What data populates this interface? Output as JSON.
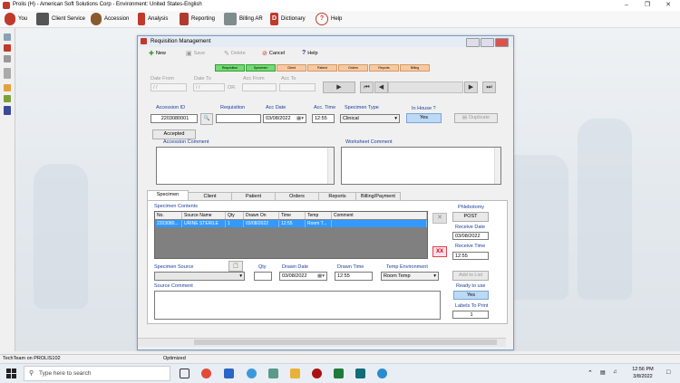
{
  "window": {
    "title": "Prolis (H) - American Soft Solutions Corp - Environment: United States-English"
  },
  "menu": [
    {
      "label": "You",
      "color": "#c0392b"
    },
    {
      "label": "Client Service",
      "color": "#555555"
    },
    {
      "label": "Accession",
      "color": "#8b5a2b"
    },
    {
      "label": "Analysis",
      "color": "#c0392b"
    },
    {
      "label": "Reporting",
      "color": "#b03a2e"
    },
    {
      "label": "Billing AR",
      "color": "#7f8c8d"
    },
    {
      "label": "Dictionary",
      "color": "#c0392b"
    },
    {
      "label": "Help",
      "color": "#c0392b"
    }
  ],
  "dialog": {
    "title": "Requisition Management",
    "toolbar": {
      "new": "New",
      "save": "Save",
      "delete": "Delete",
      "cancel": "Cancel",
      "help": "Help"
    },
    "stages": [
      "Requisition",
      "Specimen",
      "Client",
      "Patient",
      "Orders",
      "Reports",
      "Billing"
    ],
    "filter": {
      "date_from_label": "Date From",
      "date_from_value": "/ /",
      "date_to_label": "Date To",
      "date_to_value": "/ /",
      "or_label": "OR",
      "acc_from_label": "Acc From",
      "acc_to_label": "Acc To"
    },
    "fields": {
      "accession_id_label": "Accession ID",
      "accession_id_value": "2203080001",
      "requisition_label": "Requisition",
      "requisition_value": "",
      "acc_date_label": "Acc Date",
      "acc_date_value": "03/08/2022",
      "acc_time_label": "Acc. Time",
      "acc_time_value": "12:55",
      "specimen_type_label": "Specimen Type",
      "specimen_type_value": "Clinical",
      "in_house_label": "In House ?",
      "in_house_value": "Yes",
      "duplicate_label": "Duplicate",
      "accepted_label": "Accepted",
      "accession_comment_label": "Accession Comment",
      "worksheet_comment_label": "Worksheet Comment"
    },
    "tabs": [
      "Specimen",
      "Client",
      "Patient",
      "Orders",
      "Reports",
      "Billing/Payment"
    ],
    "specimen": {
      "contents_label": "Specimen Contents",
      "columns": [
        "No.",
        "Source Name",
        "Qty",
        "Drawn On",
        "Time",
        "Temp",
        "Comment"
      ],
      "rows": [
        {
          "no": "2203080...",
          "source": "URINE STERILE",
          "qty": "1",
          "drawn": "03/08/2022",
          "time": "12:55",
          "temp": "Room T...",
          "comment": ""
        }
      ],
      "remove_label": "XX",
      "source_label": "Specimen Source",
      "qty_label": "Qty",
      "drawn_date_label": "Drawn Date",
      "drawn_date_value": "03/08/2022",
      "drawn_time_label": "Drawn Time",
      "drawn_time_value": "12:55",
      "temp_env_label": "Temp Environment",
      "temp_env_value": "Room Temp",
      "add_to_list_label": "Add to List",
      "source_comment_label": "Source Comment"
    },
    "right_panel": {
      "phlebotomy_label": "Phlebotomy",
      "post_label": "POST",
      "receive_date_label": "Receive Date",
      "receive_date_value": "03/08/2022",
      "receive_time_label": "Receive Time",
      "receive_time_value": "12:55",
      "ready_label": "Ready to use",
      "ready_value": "Yes",
      "labels_label": "Labels To Print",
      "labels_value": "1"
    }
  },
  "statusbar": {
    "left": "TechTeam on PROLIS102",
    "center": "Optimized"
  },
  "taskbar": {
    "search_placeholder": "Type here to search",
    "time": "12:56 PM",
    "date": "3/8/2022"
  }
}
